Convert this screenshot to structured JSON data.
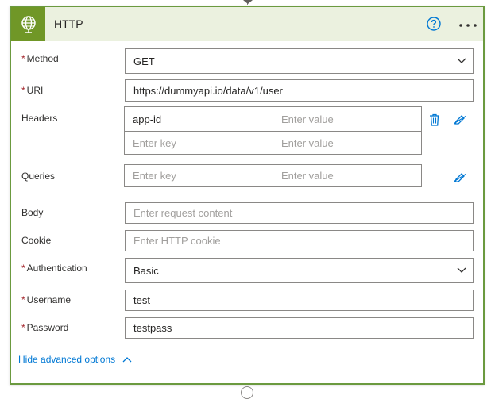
{
  "card": {
    "title": "HTTP",
    "icon": "globe-icon",
    "accent_color": "#709727",
    "border_color": "#6b9a3f",
    "header_bg": "#ebf1df"
  },
  "fields": {
    "method": {
      "label": "Method",
      "required": "*",
      "value": "GET"
    },
    "uri": {
      "label": "URI",
      "required": "*",
      "value": "https://dummyapi.io/data/v1/user"
    },
    "headers": {
      "label": "Headers",
      "rows": [
        {
          "key": "app-id",
          "value_placeholder": "Enter value"
        },
        {
          "key_placeholder": "Enter key",
          "value_placeholder": "Enter value"
        }
      ]
    },
    "queries": {
      "label": "Queries",
      "key_placeholder": "Enter key",
      "value_placeholder": "Enter value"
    },
    "body": {
      "label": "Body",
      "placeholder": "Enter request content"
    },
    "cookie": {
      "label": "Cookie",
      "placeholder": "Enter HTTP cookie"
    },
    "authentication": {
      "label": "Authentication",
      "required": "*",
      "value": "Basic"
    },
    "username": {
      "label": "Username",
      "required": "*",
      "value": "test"
    },
    "password": {
      "label": "Password",
      "required": "*",
      "value": "testpass"
    }
  },
  "footer": {
    "advanced_label": "Hide advanced options"
  }
}
